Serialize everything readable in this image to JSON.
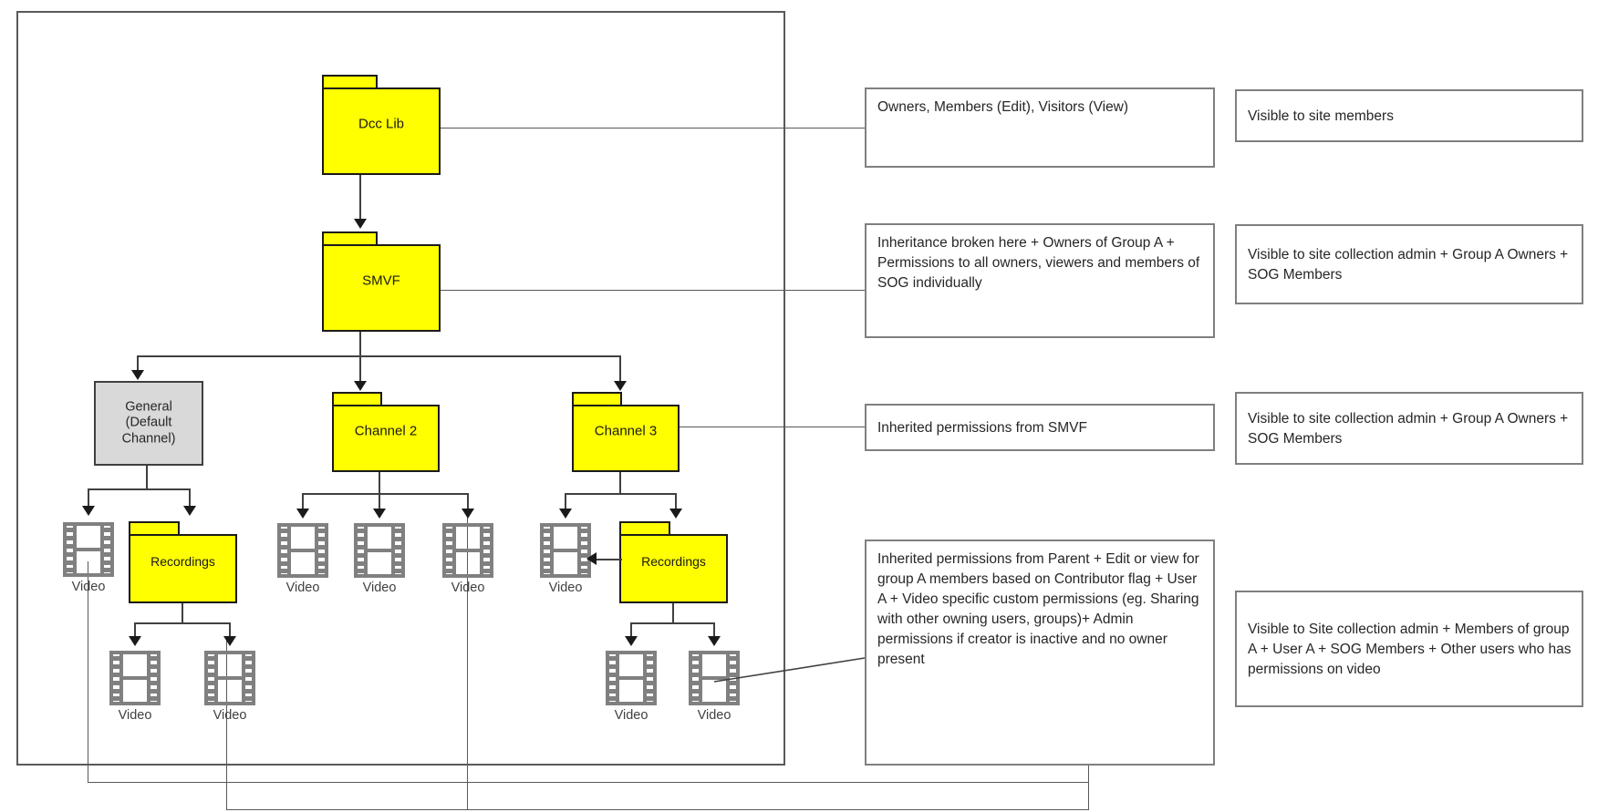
{
  "diagram": {
    "title": "SharePoint / Teams video library permissions hierarchy",
    "colors": {
      "folder_fill": "#ffff00",
      "folder_stroke": "#1a1a1a",
      "channel_default_fill": "#d9d9d9",
      "note_border": "#7f7f7f",
      "connector": "#404040",
      "frame": "#595959"
    }
  },
  "nodes": {
    "doc_lib": {
      "label": "Dcc Lib",
      "type": "folder",
      "fill": "#ffff00"
    },
    "smvf": {
      "label": "SMVF",
      "type": "folder",
      "fill": "#ffff00"
    },
    "general_channel": {
      "label": "General\n(Default\nChannel)",
      "type": "rect",
      "fill": "#d9d9d9"
    },
    "channel2": {
      "label": "Channel 2",
      "type": "folder",
      "fill": "#ffff00"
    },
    "channel3": {
      "label": "Channel 3",
      "type": "folder",
      "fill": "#ffff00"
    },
    "recordings_general": {
      "label": "Recordings",
      "type": "folder",
      "fill": "#ffff00"
    },
    "recordings_channel3": {
      "label": "Recordings",
      "type": "folder",
      "fill": "#ffff00"
    }
  },
  "videos": {
    "general_video": "Video",
    "recordings_general_video_1": "Video",
    "recordings_general_video_2": "Video",
    "channel2_video_1": "Video",
    "channel2_video_2": "Video",
    "channel2_video_3": "Video",
    "channel3_video_1": "Video",
    "recordings_channel3_video_1": "Video",
    "recordings_channel3_video_2": "Video"
  },
  "permission_notes": {
    "doc_lib": "Owners, Members (Edit), Visitors (View)",
    "smvf": "Inheritance broken here + Owners of Group A +   Permissions to all owners, viewers and members of SOG individually",
    "channel3": "Inherited permissions from SMVF",
    "video": "Inherited permissions from Parent + Edit or view for group A members based on Contributor flag + User A + Video specific custom permissions (eg. Sharing with other owning users, groups)+ Admin permissions if creator is inactive and no owner present"
  },
  "visibility_notes": {
    "doc_lib": "Visible to site members",
    "smvf": "Visible to site collection admin + Group A Owners + SOG Members",
    "channel3": "Visible to site collection admin + Group A Owners + SOG Members",
    "video": "Visible to Site collection admin + Members of group A + User A + SOG Members + Other users who has permissions on video"
  }
}
